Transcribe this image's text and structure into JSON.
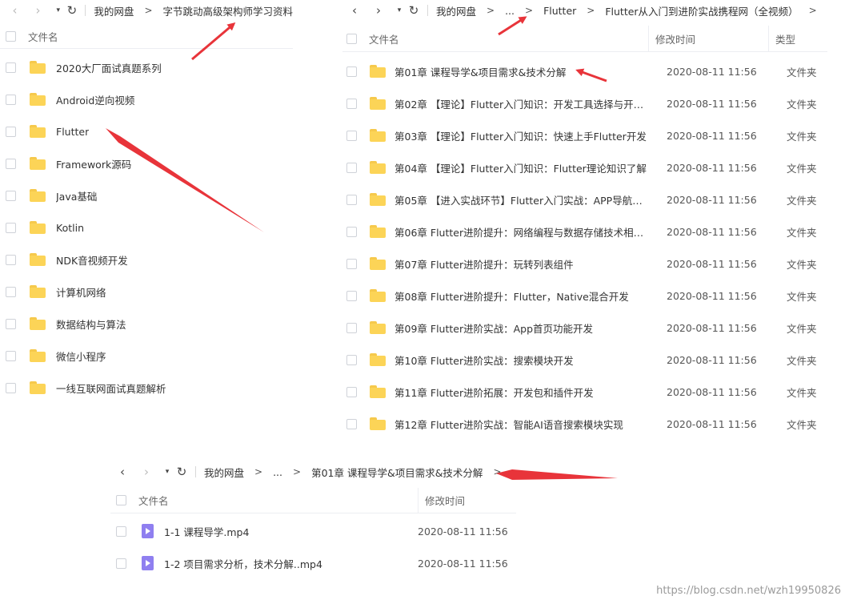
{
  "panel_a": {
    "nav": {
      "back": "‹",
      "forward": "›",
      "dropdown": "▾",
      "refresh": "↻"
    },
    "breadcrumb": [
      "我的网盘",
      "字节跳动高级架构师学习资料"
    ],
    "header": {
      "name": "文件名"
    },
    "items": [
      {
        "name": "2020大厂面试真题系列",
        "icon": "folder-icon"
      },
      {
        "name": "Android逆向视频",
        "icon": "folder-icon"
      },
      {
        "name": "Flutter",
        "icon": "folder-icon"
      },
      {
        "name": "Framework源码",
        "icon": "folder-icon"
      },
      {
        "name": "Java基础",
        "icon": "folder-icon"
      },
      {
        "name": "Kotlin",
        "icon": "folder-icon"
      },
      {
        "name": "NDK音视频开发",
        "icon": "folder-icon"
      },
      {
        "name": "计算机网络",
        "icon": "folder-icon"
      },
      {
        "name": "数据结构与算法",
        "icon": "folder-icon"
      },
      {
        "name": "微信小程序",
        "icon": "folder-icon"
      },
      {
        "name": "一线互联网面试真题解析",
        "icon": "folder-icon"
      }
    ]
  },
  "panel_b": {
    "nav": {
      "back": "‹",
      "forward": "›",
      "dropdown": "▾",
      "refresh": "↻"
    },
    "breadcrumb": [
      "我的网盘",
      "...",
      "Flutter",
      "Flutter从入门到进阶实战携程网（全视频）"
    ],
    "header": {
      "name": "文件名",
      "modified": "修改时间",
      "type": "类型"
    },
    "items": [
      {
        "name": "第01章 课程导学&项目需求&技术分解",
        "modified": "2020-08-11 11:56",
        "type": "文件夹"
      },
      {
        "name": "第02章 【理论】Flutter入门知识：开发工具选择与开发...",
        "modified": "2020-08-11 11:56",
        "type": "文件夹"
      },
      {
        "name": "第03章 【理论】Flutter入门知识：快速上手Flutter开发",
        "modified": "2020-08-11 11:56",
        "type": "文件夹"
      },
      {
        "name": "第04章 【理论】Flutter入门知识：Flutter理论知识了解",
        "modified": "2020-08-11 11:56",
        "type": "文件夹"
      },
      {
        "name": "第05章 【进入实战环节】Flutter入门实战：APP导航框...",
        "modified": "2020-08-11 11:56",
        "type": "文件夹"
      },
      {
        "name": "第06章 Flutter进阶提升：网络编程与数据存储技术相关...",
        "modified": "2020-08-11 11:56",
        "type": "文件夹"
      },
      {
        "name": "第07章 Flutter进阶提升：玩转列表组件",
        "modified": "2020-08-11 11:56",
        "type": "文件夹"
      },
      {
        "name": "第08章 Flutter进阶提升：Flutter，Native混合开发",
        "modified": "2020-08-11 11:56",
        "type": "文件夹"
      },
      {
        "name": "第09章 Flutter进阶实战：App首页功能开发",
        "modified": "2020-08-11 11:56",
        "type": "文件夹"
      },
      {
        "name": "第10章 Flutter进阶实战：搜索模块开发",
        "modified": "2020-08-11 11:56",
        "type": "文件夹"
      },
      {
        "name": "第11章 Flutter进阶拓展：开发包和插件开发",
        "modified": "2020-08-11 11:56",
        "type": "文件夹"
      },
      {
        "name": "第12章 Flutter进阶实战：智能AI语音搜索模块实现",
        "modified": "2020-08-11 11:56",
        "type": "文件夹"
      }
    ]
  },
  "panel_c": {
    "nav": {
      "back": "‹",
      "forward": "›",
      "dropdown": "▾",
      "refresh": "↻"
    },
    "breadcrumb": [
      "我的网盘",
      "...",
      "第01章 课程导学&项目需求&技术分解"
    ],
    "header": {
      "name": "文件名",
      "modified": "修改时间"
    },
    "items": [
      {
        "name": "1-1 课程导学.mp4",
        "modified": "2020-08-11 11:56"
      },
      {
        "name": "1-2 项目需求分析，技术分解..mp4",
        "modified": "2020-08-11 11:56"
      }
    ]
  },
  "watermark": "https://blog.csdn.net/wzh19950826",
  "colors": {
    "folder": "#fcd457",
    "video": "#8f7ff0",
    "annotation_arrow": "#e8343a"
  }
}
